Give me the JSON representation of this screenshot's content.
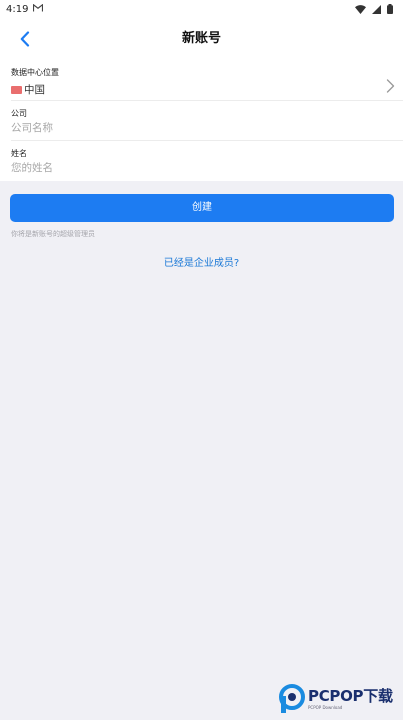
{
  "status_bar": {
    "time": "4:19",
    "gmail_icon": "gmail-icon",
    "wifi_icon": "wifi-icon",
    "signal_icon": "signal-icon",
    "battery_icon": "battery-icon"
  },
  "header": {
    "title": "新账号",
    "back_icon": "chevron-left-icon"
  },
  "form": {
    "datacenter": {
      "label": "数据中心位置",
      "value": "中国",
      "flag_icon": "china-flag-icon",
      "chevron_icon": "chevron-right-icon"
    },
    "company": {
      "label": "公司",
      "placeholder": "公司名称",
      "value": ""
    },
    "name": {
      "label": "姓名",
      "placeholder": "您的姓名",
      "value": ""
    }
  },
  "actions": {
    "create_label": "创建",
    "hint": "你将是新账号的超级管理员",
    "existing_member_link": "已经是企业成员?"
  },
  "watermark": {
    "brand": "PCPOP下载",
    "sub": "PCPOP Download"
  },
  "colors": {
    "primary": "#1d7cf2",
    "link": "#1a78d6",
    "background": "#f0f0f5",
    "flag": "#e96e6e"
  }
}
